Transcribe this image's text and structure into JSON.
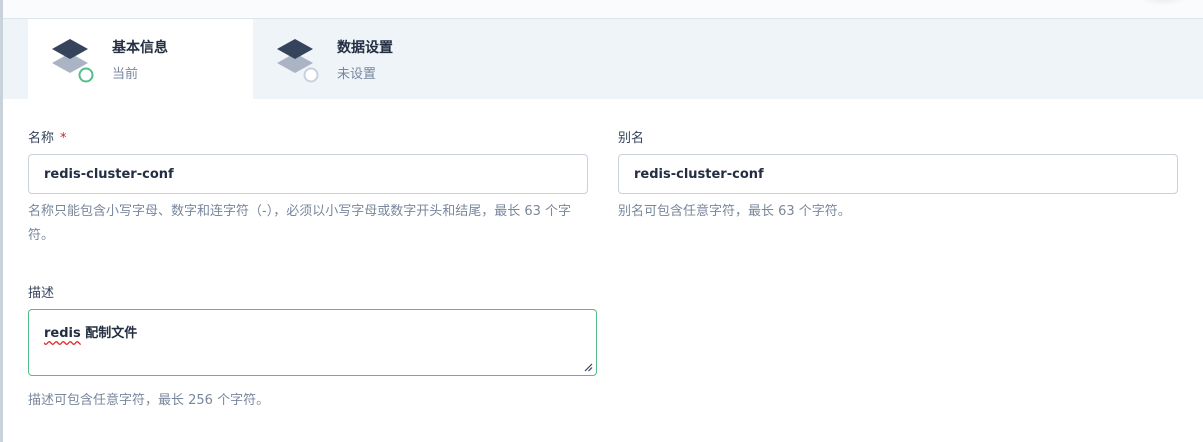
{
  "steps": [
    {
      "title": "基本信息",
      "status": "当前",
      "icon": "layers-icon",
      "state": "current"
    },
    {
      "title": "数据设置",
      "status": "未设置",
      "icon": "layers-icon",
      "state": "pending"
    }
  ],
  "form": {
    "name": {
      "label": "名称",
      "required_mark": "*",
      "value": "redis-cluster-conf",
      "hint": "名称只能包含小写字母、数字和连字符（-），必须以小写字母或数字开头和结尾，最长 63 个字符。"
    },
    "alias": {
      "label": "别名",
      "value": "redis-cluster-conf",
      "hint": "别名可包含任意字符，最长 63 个字符。"
    },
    "description": {
      "label": "描述",
      "value_word1": "redis",
      "value_rest": " 配制文件",
      "hint": "描述可包含任意字符，最长 256 个字符。"
    }
  },
  "colors": {
    "accent_green": "#55bc8a",
    "required_red": "#ca2621",
    "step_icon_dark": "#36435c",
    "step_icon_light": "#abb4c4"
  }
}
